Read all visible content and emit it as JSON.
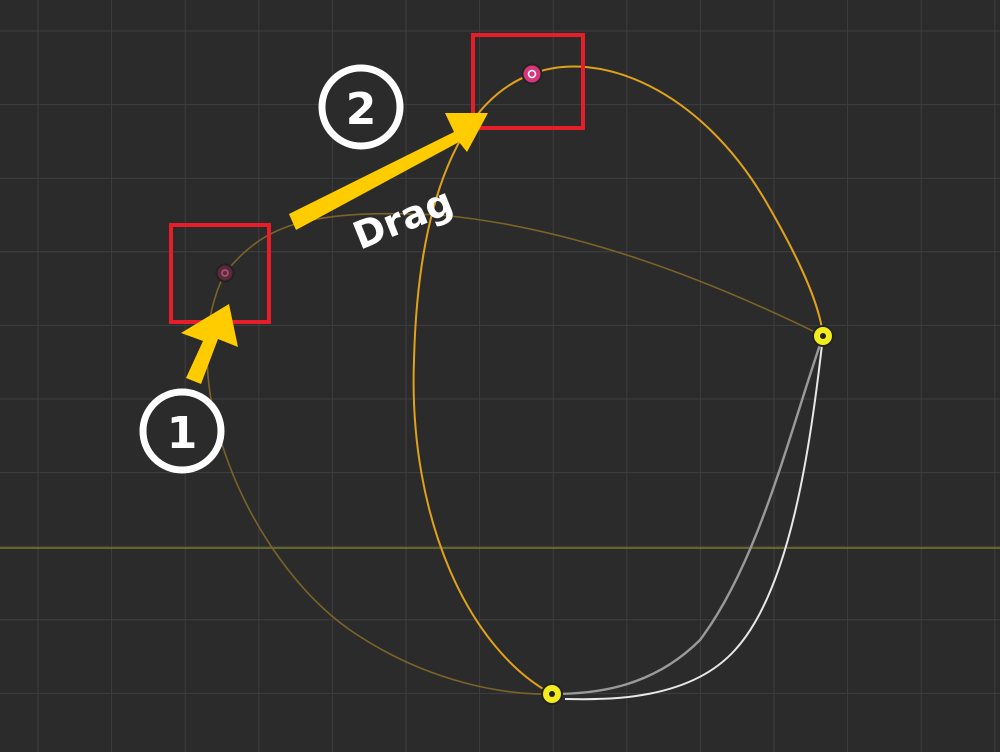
{
  "colors": {
    "background": "#2b2b2b",
    "grid_line": "#3f3f3f",
    "grid_line_minor": "#353535",
    "horizon_line": "#8a8a2a",
    "curve_active": "#e0a21a",
    "curve_dim": "#7a6428",
    "curve_white": "#e8e8e8",
    "curve_grey": "#9a9a9a",
    "node_yellow": "#f2ec1c",
    "node_pink": "#d8357a",
    "highlight_box": "#e61e2a",
    "arrow": "#ffcc00",
    "badge_fill": "#2b2b2b",
    "badge_stroke": "#ffffff"
  },
  "annotations": {
    "step1_label": "1",
    "step2_label": "2",
    "drag_label": "Drag"
  },
  "icons": {
    "start_handle": "handle-circle-icon",
    "end_handle": "handle-circle-icon",
    "vertex_right": "vertex-dot-icon",
    "vertex_bottom": "vertex-dot-icon"
  }
}
